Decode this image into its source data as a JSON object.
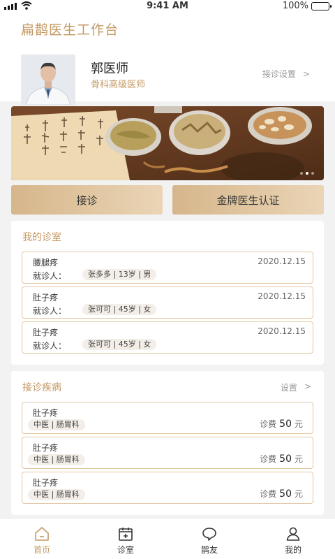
{
  "statusbar": {
    "time": "9:41 AM",
    "battery": "100%"
  },
  "header": {
    "app_title": "扁鹊医生工作台",
    "doctor_name": "郭医师",
    "doctor_title": "骨科高级医师",
    "settings_label": "接诊设置",
    "chevron": ">"
  },
  "banner": {
    "dots": 3,
    "active_dot": 2
  },
  "actions": {
    "consult_label": "接诊",
    "certify_label": "金牌医生认证"
  },
  "clinic": {
    "title": "我的诊室",
    "patient_label": "就诊人：",
    "items": [
      {
        "complaint": "腰腿疼",
        "date": "2020.12.15",
        "patient": "张多多 | 13岁 | 男"
      },
      {
        "complaint": "肚子疼",
        "date": "2020.12.15",
        "patient": "张可可 | 45岁 | 女"
      },
      {
        "complaint": "肚子疼",
        "date": "2020.12.15",
        "patient": "张可可 | 45岁 | 女"
      }
    ]
  },
  "diseases": {
    "title": "接诊疾病",
    "settings_label": "设置",
    "chevron": ">",
    "fee_label": "诊费",
    "fee_unit": "元",
    "items": [
      {
        "name": "肚子疼",
        "department": "中医 | 肠胃科",
        "fee": "50"
      },
      {
        "name": "肚子疼",
        "department": "中医 | 肠胃科",
        "fee": "50"
      },
      {
        "name": "肚子疼",
        "department": "中医 | 肠胃科",
        "fee": "50"
      }
    ]
  },
  "tabs": [
    {
      "label": "首页",
      "icon": "home-icon",
      "active": true
    },
    {
      "label": "诊室",
      "icon": "calendar-plus-icon",
      "active": false
    },
    {
      "label": "鹊友",
      "icon": "chat-bubble-icon",
      "active": false
    },
    {
      "label": "我的",
      "icon": "user-icon",
      "active": false
    }
  ],
  "colors": {
    "accent": "#c49863",
    "card_border": "#e3c7a3",
    "button_gradient_start": "#d6b68b",
    "button_gradient_end": "#ead5b6"
  }
}
